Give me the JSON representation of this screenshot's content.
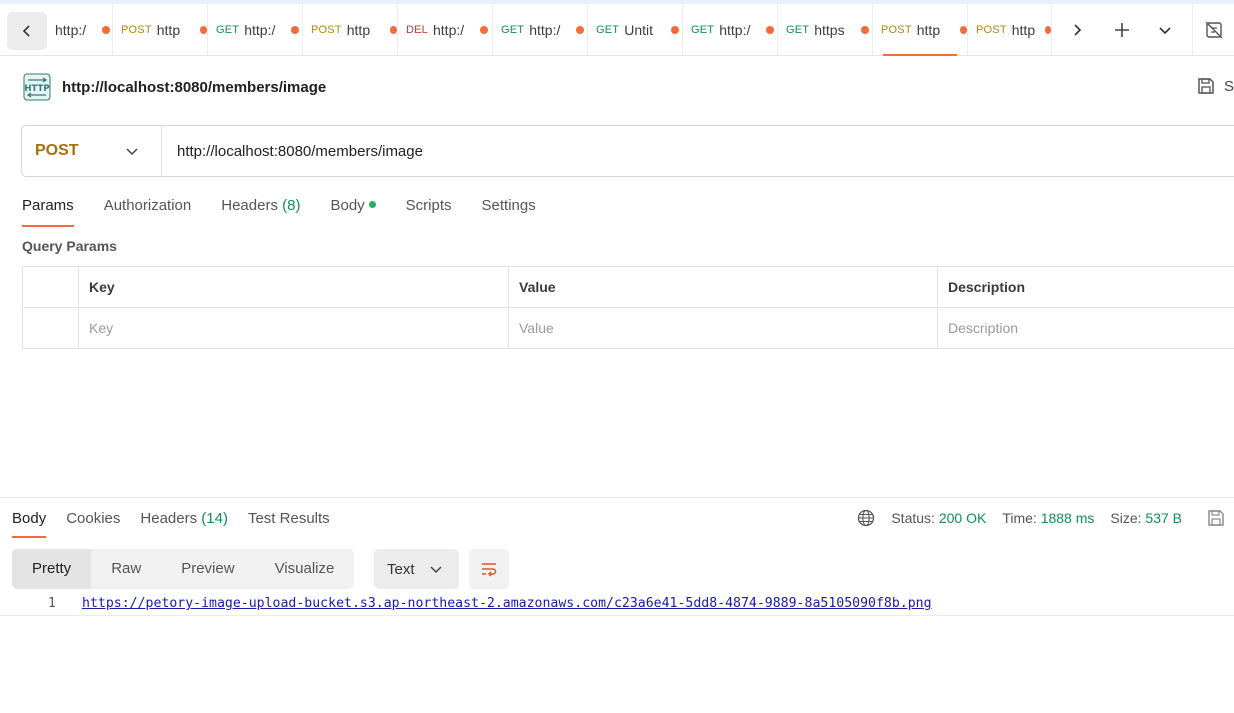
{
  "tabs": [
    {
      "method": "",
      "url": "http:/",
      "method_class": ""
    },
    {
      "method": "POST",
      "url": "http",
      "method_class": "m-post"
    },
    {
      "method": "GET",
      "url": "http:/",
      "method_class": "m-get"
    },
    {
      "method": "POST",
      "url": "http",
      "method_class": "m-post"
    },
    {
      "method": "DEL",
      "url": "http:/",
      "method_class": "m-del"
    },
    {
      "method": "GET",
      "url": "http:/",
      "method_class": "m-get"
    },
    {
      "method": "GET",
      "url": "Untit",
      "method_class": "m-get"
    },
    {
      "method": "GET",
      "url": "http:/",
      "method_class": "m-get"
    },
    {
      "method": "GET",
      "url": "https",
      "method_class": "m-get"
    },
    {
      "method": "POST",
      "url": "http",
      "method_class": "m-post"
    },
    {
      "method": "POST",
      "url": "http",
      "method_class": "m-post"
    }
  ],
  "active_tab_index": 9,
  "request": {
    "title": "http://localhost:8080/members/image",
    "save_label": "S",
    "method": "POST",
    "url": "http://localhost:8080/members/image"
  },
  "request_tabs": {
    "params": "Params",
    "authorization": "Authorization",
    "headers": "Headers",
    "headers_count": "(8)",
    "body": "Body",
    "scripts": "Scripts",
    "settings": "Settings"
  },
  "query_params": {
    "label": "Query Params",
    "headers": {
      "key": "Key",
      "value": "Value",
      "description": "Description"
    },
    "placeholders": {
      "key": "Key",
      "value": "Value",
      "description": "Description"
    }
  },
  "response": {
    "tabs": {
      "body": "Body",
      "cookies": "Cookies",
      "headers": "Headers",
      "headers_count": "(14)",
      "test_results": "Test Results"
    },
    "status_label": "Status:",
    "status_value": "200 OK",
    "time_label": "Time:",
    "time_value": "1888 ms",
    "size_label": "Size:",
    "size_value": "537 B",
    "views": {
      "pretty": "Pretty",
      "raw": "Raw",
      "preview": "Preview",
      "visualize": "Visualize"
    },
    "format": "Text",
    "line_number": "1",
    "body_line": "https://petory-image-upload-bucket.s3.ap-northeast-2.amazonaws.com/c23a6e41-5dd8-4874-9889-8a5105090f8b.png"
  },
  "colors": {
    "accent": "#f26b3a",
    "get": "#0f8f5b",
    "post": "#b7860b",
    "delete": "#c23b3b",
    "success": "#0f8f5b"
  }
}
